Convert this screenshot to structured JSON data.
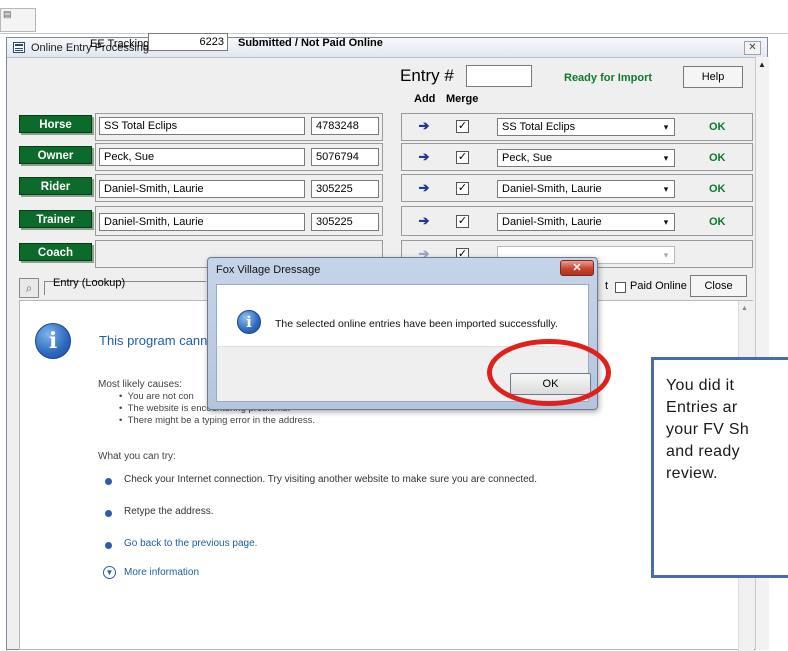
{
  "form": {
    "title": "Online Entry Processing",
    "close_glyph": "✕",
    "tracking_label": "EE Tracking #",
    "tracking_value": "6223",
    "status": "Submitted / Not Paid Online",
    "entry_label": "Entry #",
    "entry_value": "",
    "ready_text": "Ready for Import",
    "help_label": "Help",
    "add_label": "Add",
    "merge_label": "Merge",
    "rows": [
      {
        "label": "Horse",
        "name": "SS Total Eclips",
        "id": "4783248",
        "match": "SS Total Eclips",
        "status": "OK"
      },
      {
        "label": "Owner",
        "name": "Peck, Sue",
        "id": "5076794",
        "match": "Peck, Sue",
        "status": "OK"
      },
      {
        "label": "Rider",
        "name": "Daniel-Smith, Laurie",
        "id": "305225",
        "match": "Daniel-Smith, Laurie",
        "status": "OK"
      },
      {
        "label": "Trainer",
        "name": "Daniel-Smith, Laurie",
        "id": "305225",
        "match": "Daniel-Smith, Laurie",
        "status": "OK"
      },
      {
        "label": "Coach",
        "name": "",
        "id": "",
        "match": "",
        "status": ""
      }
    ],
    "lookup_label": "Entry (Lookup)",
    "paid_prefix": "t",
    "paid_label": "Paid Online",
    "close_label": "Close"
  },
  "web_error": {
    "title": "This program cannot",
    "causes_heading": "Most likely causes:",
    "causes": [
      "You are not con",
      "The website is encountering problems.",
      "There might be a typing error in the address."
    ],
    "try_heading": "What you can try:",
    "tries": [
      {
        "text": "Check your Internet connection. Try visiting another website to make sure you are connected.",
        "link": false
      },
      {
        "text": "Retype the address.",
        "link": false
      },
      {
        "text": "Go back to the previous page.",
        "link": true
      }
    ],
    "more_info": "More information"
  },
  "dialog": {
    "title": "Fox Village Dressage",
    "close_glyph": "✕",
    "message": "The selected online entries have been imported successfully.",
    "ok_label": "OK"
  },
  "callout": {
    "text": "You did it\nEntries ar\nyour FV Sh\nand ready\nreview."
  },
  "colors": {
    "label_green": "#0c6b2a",
    "ok_green": "#0c7a2a",
    "highlight_red": "#e0201a",
    "callout_border": "#4a6ba8"
  },
  "icons": [
    "form-window-icon",
    "info-icon",
    "close-icon",
    "add-arrow-icon",
    "checkbox-icon",
    "dropdown-arrow-icon"
  ]
}
